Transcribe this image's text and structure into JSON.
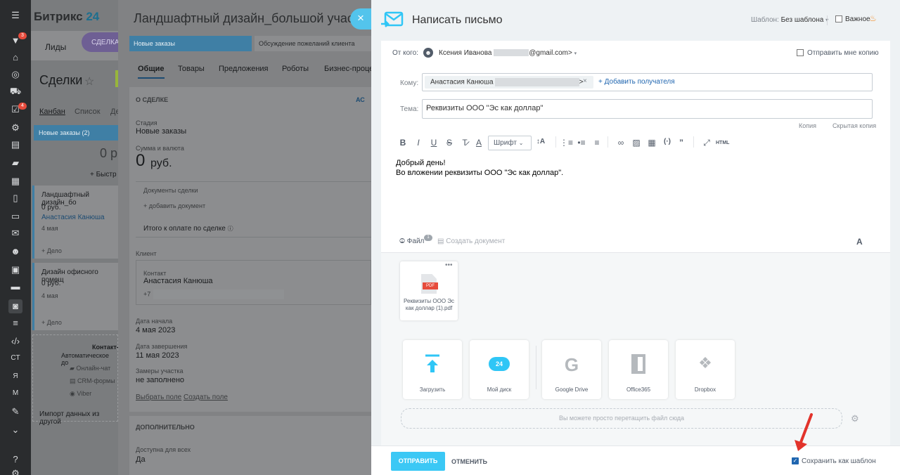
{
  "rail": {
    "badges": [
      "3",
      "4"
    ],
    "text_items": [
      "CT",
      "Я",
      "M"
    ]
  },
  "deals": {
    "logo_main": "Битрикс",
    "logo_num": "24",
    "tab_leads": "Лиды",
    "tab_deals": "СДЕЛКА",
    "title": "Сделки",
    "view_kanban": "Канбан",
    "view_list": "Список",
    "view_more": "Де",
    "stage": "Новые заказы",
    "stage_count": "(2)",
    "stage_sum": "0 р",
    "quick_add": "+ Быстр",
    "card1": {
      "title": "Ландшафтный дизайн_бо",
      "sum": "0 руб.",
      "contact": "Анастасия Канюша",
      "date": "4 мая",
      "task": "+ Дело"
    },
    "card2": {
      "title": "Дизайн офисного помещ",
      "sum": "0 руб.",
      "date": "4 мая",
      "task": "+ Дело"
    },
    "contact_center": {
      "title": "Контакт-",
      "subtitle": "Автоматическое до",
      "items": [
        "Онлайн-чат",
        "CRM-формы",
        "Viber"
      ]
    },
    "import": "Импорт данных из другой"
  },
  "deal": {
    "title": "Ландшафтный дизайн_большой участо",
    "stage1": "Новые заказы",
    "stage2": "Обсуждение пожеланий клиента",
    "tabs": [
      "Общие",
      "Товары",
      "Предложения",
      "Роботы",
      "Бизнес-процес"
    ],
    "section_about": "О СДЕЛКЕ",
    "add_btn": "АС",
    "stage_label": "Стадия",
    "stage_value": "Новые заказы",
    "sum_label": "Сумма и валюта",
    "sum_value": "0",
    "sum_currency": "руб.",
    "docs_label": "Документы сделки",
    "docs_add": "+ добавить документ",
    "total_label": "Итого к оплате по сделке",
    "client_label": "Клиент",
    "contact_label": "Контакт",
    "contact_name": "Анастасия Канюша",
    "contact_phone": "+7",
    "start_label": "Дата начала",
    "start_value": "4 мая 2023",
    "end_label": "Дата завершения",
    "end_value": "11 мая 2023",
    "measure_label": "Замеры участка",
    "measure_value": "не заполнено",
    "select_field": "Выбрать поле",
    "create_field": "Создать поле",
    "section_extra": "ДОПОЛНИТЕЛЬНО",
    "avail_label": "Доступна для всех",
    "avail_value": "Да"
  },
  "email": {
    "title": "Написать письмо",
    "template_label": "Шаблон:",
    "template_value": "Без шаблона",
    "important": "Важное",
    "from_label": "От кого:",
    "from_name": "Ксения Иванова",
    "from_email_suffix": "@gmail.com>",
    "send_copy": "Отправить мне копию",
    "to_label": "Кому:",
    "to_name": "Анастасия Канюша",
    "to_suffix": ">",
    "add_recipient": "+ Добавить получателя",
    "subject_label": "Тема:",
    "subject_value": "Реквизиты ООО \"Эс как доллар\"",
    "cc": "Копия",
    "bcc": "Скрытая копия",
    "font_select": "Шрифт",
    "html_btn": "HTML",
    "body_line1": "Добрый день!",
    "body_line2": "Во вложении реквизиты ООО \"Эс как доллар\".",
    "file_tab": "Файл",
    "file_count": "1",
    "create_doc": "Создать документ",
    "attachment_name": "Реквизиты ООО Эс как доллар (1).pdf",
    "attachment_badge": "PDF",
    "sources": [
      "Загрузить",
      "Мой диск",
      "Google Drive",
      "Office365",
      "Dropbox"
    ],
    "disk_badge": "24",
    "drop_hint": "Вы можете просто перетащить файл сюда",
    "send": "ОТПРАВИТЬ",
    "cancel": "ОТМЕНИТЬ",
    "save_template": "Сохранить как шаблон"
  }
}
